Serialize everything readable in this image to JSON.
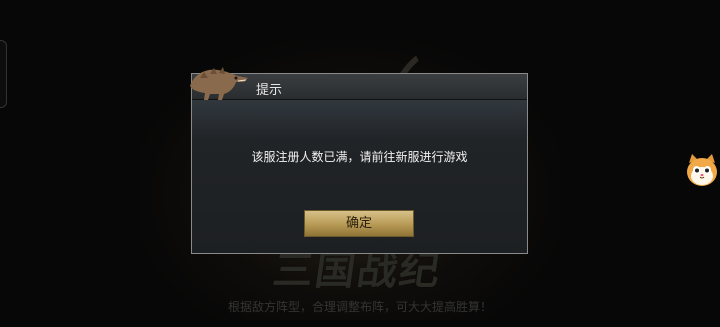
{
  "dialog": {
    "title": "提示",
    "message": "该服注册人数已满，请前往新服进行游戏",
    "confirm_label": "确定"
  },
  "background": {
    "logo_text": "三国战纪",
    "tip_text": "根据敌方阵型，合理调整布阵，可大大提高胜算！"
  },
  "colors": {
    "accent_gold": "#c9ae6a",
    "dialog_bg": "#202326",
    "header_bg": "#323537"
  },
  "icons": {
    "header_art": "dinosaur-icon",
    "floating": "cat-mascot-icon"
  }
}
